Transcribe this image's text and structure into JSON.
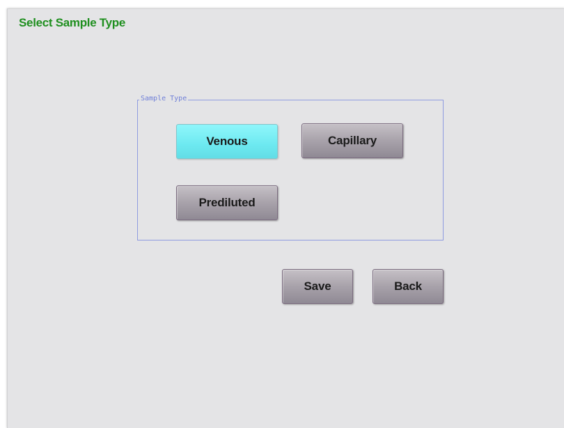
{
  "page": {
    "title": "Select Sample Type",
    "title_color": "#1f8f1f",
    "background_color": "#e4e4e6"
  },
  "sample_type_group": {
    "legend": "Sample Type",
    "legend_color": "#6f7fd8",
    "border_color": "#8e9be0",
    "options": [
      {
        "label": "Venous",
        "selected": true
      },
      {
        "label": "Capillary",
        "selected": false
      },
      {
        "label": "Prediluted",
        "selected": false
      }
    ],
    "selected_color": "#7df0f6"
  },
  "actions": {
    "save_label": "Save",
    "back_label": "Back"
  }
}
